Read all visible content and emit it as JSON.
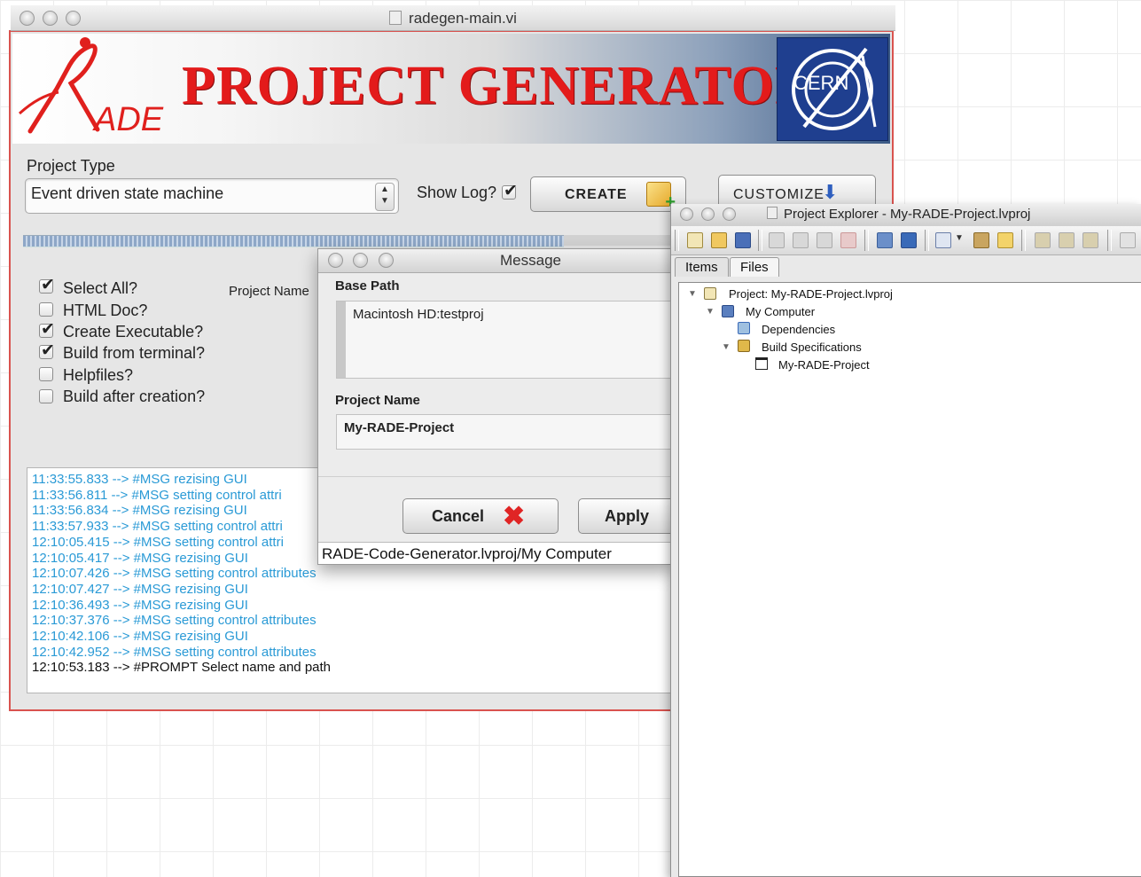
{
  "main_window": {
    "title": "radegen-main.vi",
    "logo_text": "ADE",
    "banner_title": "PROJECT GENERATOR",
    "cern_logo_text": "CERN",
    "project_type_label": "Project Type",
    "project_type_value": "Event driven state machine",
    "show_log_label": "Show Log?",
    "show_log_checked": true,
    "create_label": "CREATE",
    "customize_label": "CUSTOMIZE",
    "project_name_label": "Project Name",
    "options": [
      {
        "label": "Select All?",
        "checked": true
      },
      {
        "label": "HTML Doc?",
        "checked": false
      },
      {
        "label": "Create Executable?",
        "checked": true
      },
      {
        "label": "Build from terminal?",
        "checked": true
      },
      {
        "label": "Helpfiles?",
        "checked": false
      },
      {
        "label": "Build after creation?",
        "checked": false
      }
    ],
    "log_lines": [
      "11:33:55.833 --> #MSG rezising GUI",
      "11:33:56.811 --> #MSG setting control attri",
      "11:33:56.834 --> #MSG rezising GUI",
      "11:33:57.933 --> #MSG setting control attri",
      "12:10:05.415 --> #MSG setting control attri",
      "12:10:05.417 --> #MSG rezising GUI",
      "12:10:07.426 --> #MSG setting control attributes",
      "12:10:07.427 --> #MSG rezising GUI",
      "12:10:36.493 --> #MSG rezising GUI",
      "12:10:37.376 --> #MSG setting control attributes",
      "12:10:42.106 --> #MSG rezising GUI",
      "12:10:42.952 --> #MSG setting control attributes",
      "12:10:53.183 --> #PROMPT Select name and path"
    ],
    "colors": {
      "accent_red": "#e31b1b",
      "log_msg": "#2a9ad6",
      "cern_blue": "#1f3f8f"
    }
  },
  "message_dialog": {
    "title": "Message",
    "base_path_label": "Base Path",
    "base_path_value": "Macintosh HD:testproj",
    "project_name_label": "Project Name",
    "project_name_value": "My-RADE-Project",
    "cancel_label": "Cancel",
    "apply_label": "Apply",
    "status_text": "RADE-Code-Generator.lvproj/My Computer"
  },
  "project_explorer": {
    "title": "Project Explorer - My-RADE-Project.lvproj",
    "tabs": [
      "Items",
      "Files"
    ],
    "tree": {
      "project": "Project: My-RADE-Project.lvproj",
      "my_computer": "My Computer",
      "dependencies": "Dependencies",
      "build_specs": "Build Specifications",
      "build_item": "My-RADE-Project"
    }
  }
}
